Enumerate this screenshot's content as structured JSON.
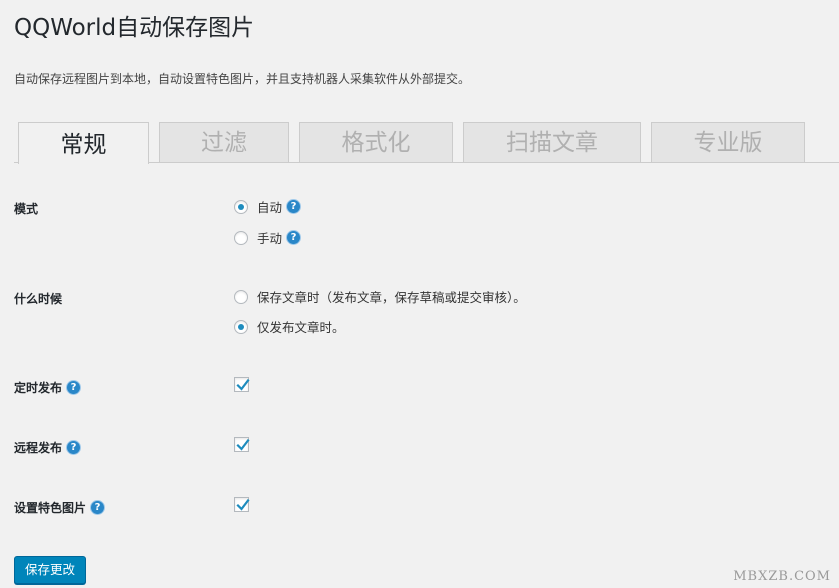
{
  "header": {
    "title": "QQWorld自动保存图片",
    "description": "自动保存远程图片到本地，自动设置特色图片，并且支持机器人采集软件从外部提交。"
  },
  "tabs": [
    {
      "label": "常规",
      "active": true
    },
    {
      "label": "过滤",
      "active": false
    },
    {
      "label": "格式化",
      "active": false
    },
    {
      "label": "扫描文章",
      "active": false
    },
    {
      "label": "专业版",
      "active": false
    }
  ],
  "settings": {
    "mode": {
      "label": "模式",
      "options": [
        {
          "label": "自动",
          "checked": true,
          "help": "?"
        },
        {
          "label": "手动",
          "checked": false,
          "help": "?"
        }
      ]
    },
    "when": {
      "label": "什么时候",
      "options": [
        {
          "label": "保存文章时（发布文章，保存草稿或提交审核）。",
          "checked": false
        },
        {
          "label": "仅发布文章时。",
          "checked": true
        }
      ]
    },
    "scheduled": {
      "label": "定时发布",
      "help": "?",
      "checked": true
    },
    "remote": {
      "label": "远程发布",
      "help": "?",
      "checked": true
    },
    "featured": {
      "label": "设置特色图片",
      "help": "?",
      "checked": true
    }
  },
  "actions": {
    "save_label": "保存更改"
  },
  "watermark": "MBXZB.COM",
  "colors": {
    "accent": "#0085ba",
    "help_icon": "#2a87c8",
    "radio_dot": "#1e8cbe",
    "checkmark": "#1e8cbe"
  }
}
